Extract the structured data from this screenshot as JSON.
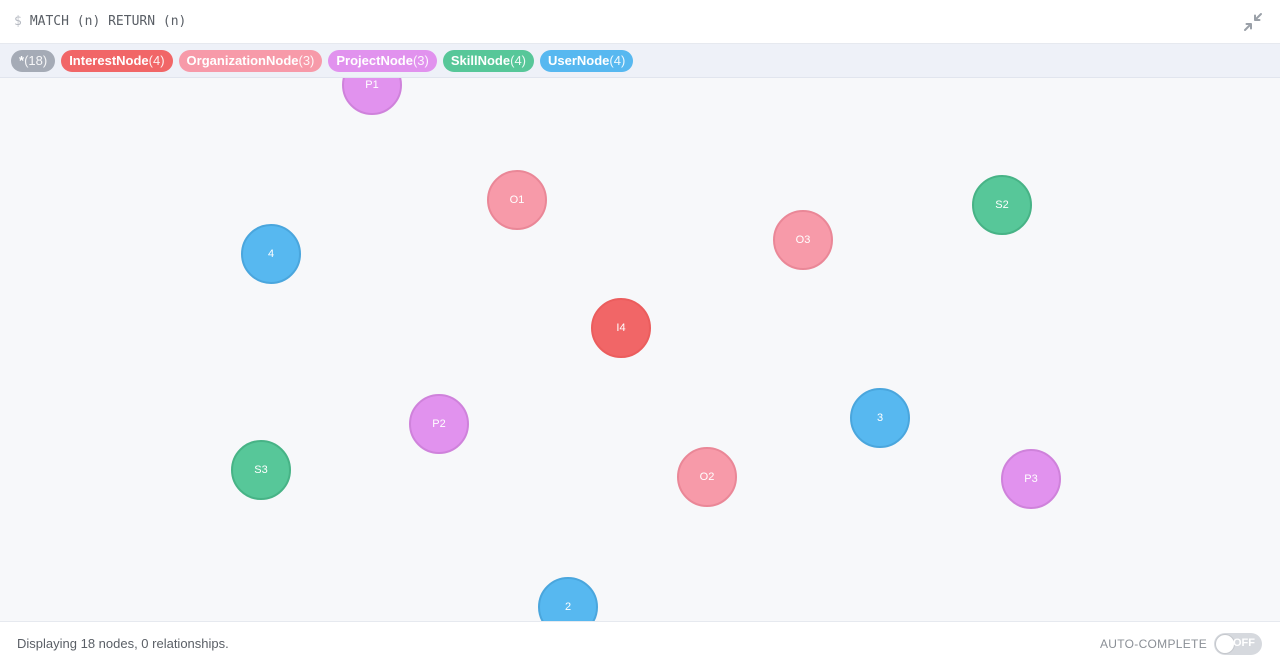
{
  "query": {
    "prompt": "$",
    "text": "MATCH (n) RETURN (n)"
  },
  "legend": [
    {
      "name": "*",
      "count": "(18)",
      "color": "#a5abb6",
      "key": "all"
    },
    {
      "name": "InterestNode",
      "count": "(4)",
      "color": "#f16667",
      "key": "interest"
    },
    {
      "name": "OrganizationNode",
      "count": "(3)",
      "color": "#f79aa9",
      "key": "organization"
    },
    {
      "name": "ProjectNode",
      "count": "(3)",
      "color": "#e192ee",
      "key": "project"
    },
    {
      "name": "SkillNode",
      "count": "(4)",
      "color": "#57c799",
      "key": "skill"
    },
    {
      "name": "UserNode",
      "count": "(4)",
      "color": "#57b8f0",
      "key": "user"
    }
  ],
  "nodes": [
    {
      "label": "P1",
      "type": "project"
    },
    {
      "label": "O1",
      "type": "organization"
    },
    {
      "label": "S2",
      "type": "skill"
    },
    {
      "label": "4",
      "type": "user"
    },
    {
      "label": "O3",
      "type": "organization"
    },
    {
      "label": "I4",
      "type": "interest"
    },
    {
      "label": "P2",
      "type": "project"
    },
    {
      "label": "3",
      "type": "user"
    },
    {
      "label": "S3",
      "type": "skill"
    },
    {
      "label": "O2",
      "type": "organization"
    },
    {
      "label": "P3",
      "type": "project"
    },
    {
      "label": "2",
      "type": "user"
    },
    {
      "label": "",
      "type": "interest"
    }
  ],
  "status": {
    "text": "Displaying 18 nodes, 0 relationships.",
    "autocomplete_label": "AUTO-COMPLETE",
    "toggle_state": "OFF"
  }
}
